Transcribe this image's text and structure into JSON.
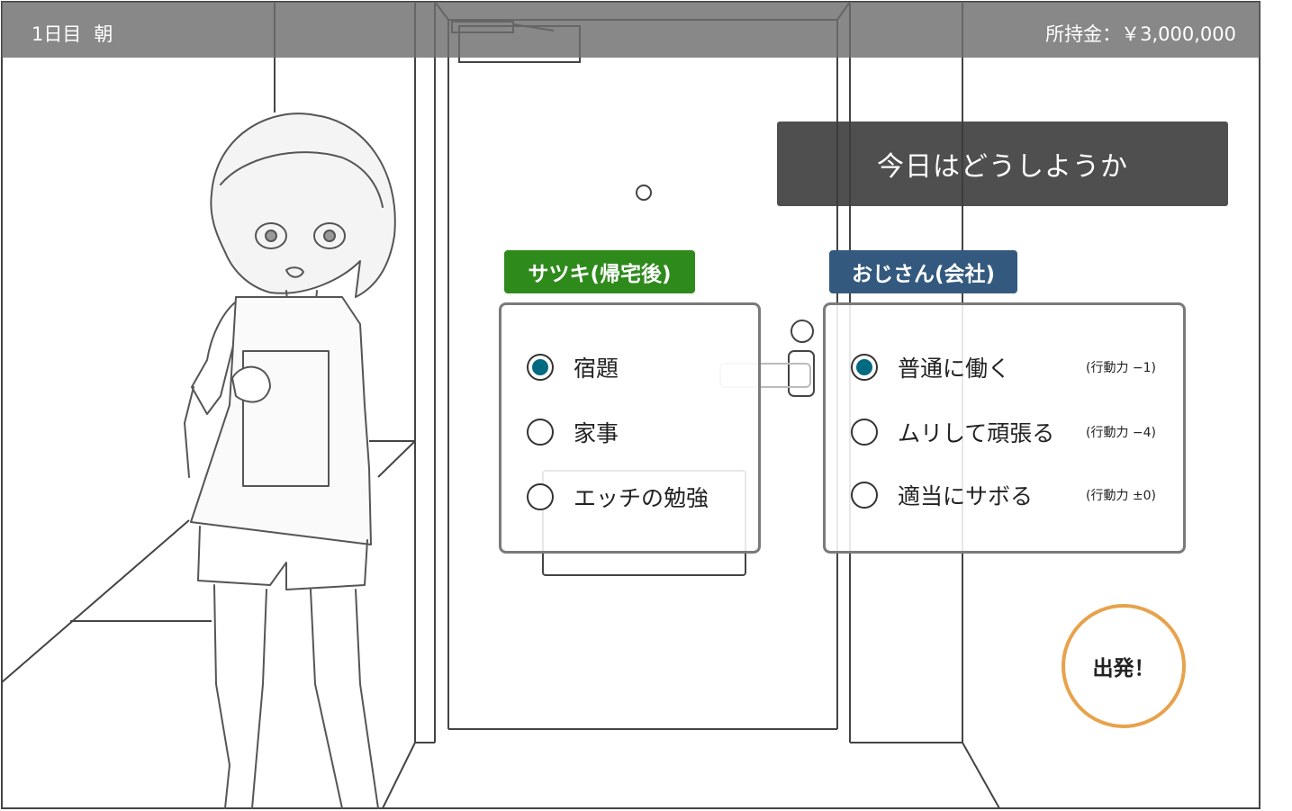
{
  "header": {
    "day": "1日目",
    "time_of_day": "朝",
    "money_label": "所持金：",
    "money_value": "￥3,000,000"
  },
  "prompt": "今日はどうしようか",
  "satsuki": {
    "tag": "サツキ(帰宅後)",
    "tag_color": "#2f8a1c",
    "options": [
      {
        "label": "宿題",
        "selected": true
      },
      {
        "label": "家事",
        "selected": false
      },
      {
        "label": "エッチの勉強",
        "selected": false
      }
    ]
  },
  "ojisan": {
    "tag": "おじさん(会社)",
    "tag_color": "#34597f",
    "options": [
      {
        "label": "普通に働く",
        "cost": "(行動力 −1)",
        "selected": true
      },
      {
        "label": "ムリして頑張る",
        "cost": "(行動力 −4)",
        "selected": false
      },
      {
        "label": "適当にサボる",
        "cost": "(行動力 ±0)",
        "selected": false
      }
    ]
  },
  "depart_button": "出発！",
  "colors": {
    "radio_selected": "#006a80",
    "depart_ring": "#e8a24c"
  }
}
